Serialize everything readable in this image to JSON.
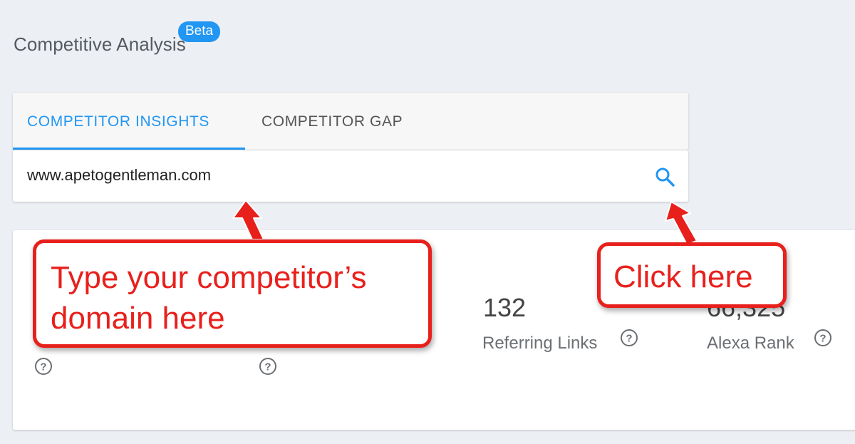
{
  "header": {
    "title": "Competitive Analysis",
    "badge": "Beta"
  },
  "tabs": [
    {
      "label": "COMPETITOR INSIGHTS",
      "active": true
    },
    {
      "label": "COMPETITOR GAP",
      "active": false
    }
  ],
  "search": {
    "value": "www.apetogentleman.com",
    "icon": "search-icon"
  },
  "stats": [
    {
      "value": "132",
      "label": "Referring Links"
    },
    {
      "value": "66,325",
      "label": "Alexa Rank"
    }
  ],
  "annotations": {
    "left_callout_line1": "Type your competitor’s",
    "left_callout_line2": "domain here",
    "right_callout": "Click here"
  },
  "colors": {
    "accent": "#2196f3",
    "annotation_red": "#e8201c",
    "background": "#eceff3"
  }
}
